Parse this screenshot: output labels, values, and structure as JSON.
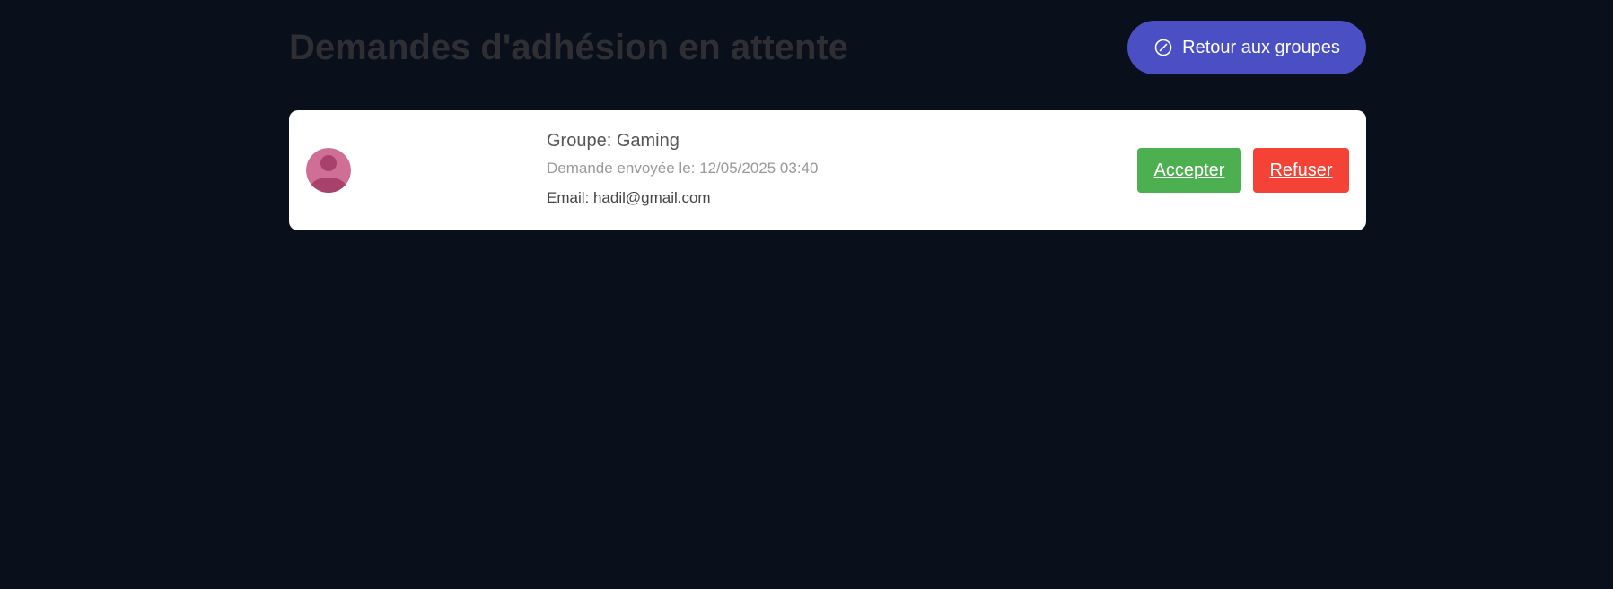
{
  "header": {
    "title": "Demandes d'adhésion en attente",
    "back_button_label": "Retour aux groupes",
    "back_button_icon": "slash-circle-icon"
  },
  "requests": [
    {
      "avatar_icon": "user-avatar-icon",
      "group_line": "Groupe: Gaming",
      "date_line": "Demande envoyée le: 12/05/2025 03:40",
      "email_line": "Email: hadil@gmail.com",
      "accept_label": "Accepter",
      "refuse_label": "Refuser"
    }
  ],
  "colors": {
    "background": "#0a0f1c",
    "primary": "#4b4fc4",
    "accept": "#4caf50",
    "refuse": "#f44336",
    "avatar": "#cf6f95"
  }
}
